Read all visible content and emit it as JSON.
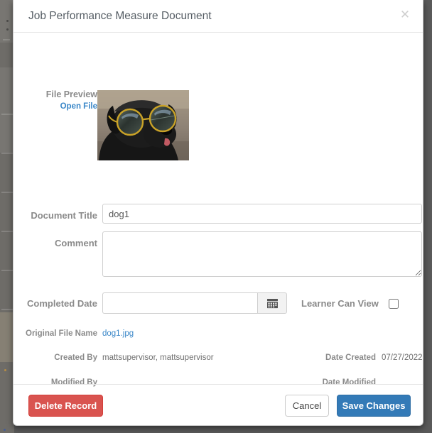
{
  "modal": {
    "title": "Job Performance Measure Document",
    "close_icon": "close-icon"
  },
  "preview": {
    "label": "File Preview",
    "open_file_link": "Open File",
    "image_alt": "black pug wearing sunglasses"
  },
  "form": {
    "document_title": {
      "label": "Document Title",
      "value": "dog1",
      "placeholder": ""
    },
    "comment": {
      "label": "Comment",
      "value": "",
      "placeholder": ""
    },
    "completed_date": {
      "label": "Completed Date",
      "value": "",
      "placeholder": "",
      "calendar_icon": "calendar-icon"
    },
    "learner_can_view": {
      "label": "Learner Can View",
      "checked": false
    }
  },
  "metadata": {
    "original_file_name": {
      "label": "Original File Name",
      "value": "dog1.jpg"
    },
    "created_by": {
      "label": "Created By",
      "value": "mattsupervisor, mattsupervisor"
    },
    "date_created": {
      "label": "Date Created",
      "value": "07/27/2022"
    },
    "modified_by": {
      "label": "Modified By",
      "value": ""
    },
    "date_modified": {
      "label": "Date Modified",
      "value": ""
    }
  },
  "footer": {
    "delete_label": "Delete Record",
    "cancel_label": "Cancel",
    "save_label": "Save Changes"
  },
  "colors": {
    "danger": "#d9534f",
    "primary": "#337ab7",
    "link": "#3a87c8",
    "label_text": "#8a8a8a",
    "title_text": "#555d64",
    "backdrop": "#5a5a5a"
  }
}
